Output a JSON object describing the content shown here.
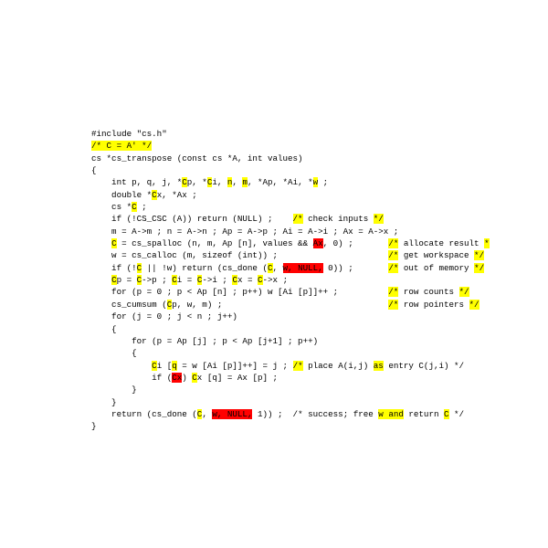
{
  "lines": [
    {
      "type": "plain",
      "text": "#include \"cs.h\""
    },
    {
      "type": "hl",
      "parts": [
        {
          "c": "hy",
          "t": "/* C = A' */"
        }
      ]
    },
    {
      "type": "plain",
      "text": "cs *cs_transpose (const cs *A, int values)"
    },
    {
      "type": "plain",
      "text": "{"
    },
    {
      "type": "hl",
      "parts": [
        {
          "c": "",
          "t": "    int p, q, j, *"
        },
        {
          "c": "hy",
          "t": "C"
        },
        {
          "c": "",
          "t": "p, *"
        },
        {
          "c": "hy",
          "t": "C"
        },
        {
          "c": "",
          "t": "i, "
        },
        {
          "c": "hy",
          "t": "n"
        },
        {
          "c": "",
          "t": ", "
        },
        {
          "c": "hy",
          "t": "m"
        },
        {
          "c": "",
          "t": ", *Ap, *Ai, *"
        },
        {
          "c": "hy",
          "t": "w"
        },
        {
          "c": "",
          "t": " ;"
        }
      ]
    },
    {
      "type": "hl",
      "parts": [
        {
          "c": "",
          "t": "    double *"
        },
        {
          "c": "hy",
          "t": "C"
        },
        {
          "c": "",
          "t": "x, *Ax ;"
        }
      ]
    },
    {
      "type": "hl",
      "parts": [
        {
          "c": "",
          "t": "    cs *"
        },
        {
          "c": "hy",
          "t": "C"
        },
        {
          "c": "",
          "t": " ;"
        }
      ]
    },
    {
      "type": "hl",
      "parts": [
        {
          "c": "",
          "t": "    if (!CS_CSC (A)) return (NULL) ;    "
        },
        {
          "c": "hy",
          "t": "/*"
        },
        {
          "c": "",
          "t": " check inputs "
        },
        {
          "c": "hy",
          "t": "*/"
        }
      ]
    },
    {
      "type": "plain",
      "text": "    m = A->m ; n = A->n ; Ap = A->p ; Ai = A->i ; Ax = A->x ;"
    },
    {
      "type": "hl",
      "parts": [
        {
          "c": "",
          "t": "    "
        },
        {
          "c": "hy",
          "t": "C"
        },
        {
          "c": "",
          "t": " = cs_spalloc (n, m, Ap [n], values && "
        },
        {
          "c": "hr",
          "t": "Ax"
        },
        {
          "c": "",
          "t": ", 0) ;       "
        },
        {
          "c": "hy",
          "t": "/*"
        },
        {
          "c": "",
          "t": " allocate result "
        },
        {
          "c": "hy",
          "t": "*"
        }
      ]
    },
    {
      "type": "hl",
      "parts": [
        {
          "c": "",
          "t": "    w = cs_calloc (m, sizeof (int)) ;                      "
        },
        {
          "c": "hy",
          "t": "/*"
        },
        {
          "c": "",
          "t": " get workspace "
        },
        {
          "c": "hy",
          "t": "*/"
        }
      ]
    },
    {
      "type": "hl",
      "parts": [
        {
          "c": "",
          "t": "    if (!"
        },
        {
          "c": "hy",
          "t": "C"
        },
        {
          "c": "",
          "t": " || !w) return (cs_done ("
        },
        {
          "c": "hy",
          "t": "C"
        },
        {
          "c": "",
          "t": ", "
        },
        {
          "c": "hr",
          "t": "w, NULL,"
        },
        {
          "c": "",
          "t": " 0)) ;       "
        },
        {
          "c": "hy",
          "t": "/*"
        },
        {
          "c": "",
          "t": " out of memory "
        },
        {
          "c": "hy",
          "t": "*/"
        }
      ]
    },
    {
      "type": "hl",
      "parts": [
        {
          "c": "",
          "t": "    "
        },
        {
          "c": "hy",
          "t": "C"
        },
        {
          "c": "",
          "t": "p = "
        },
        {
          "c": "hy",
          "t": "C"
        },
        {
          "c": "",
          "t": "->p ; "
        },
        {
          "c": "hy",
          "t": "C"
        },
        {
          "c": "",
          "t": "i = "
        },
        {
          "c": "hy",
          "t": "C"
        },
        {
          "c": "",
          "t": "->i ; "
        },
        {
          "c": "hy",
          "t": "C"
        },
        {
          "c": "",
          "t": "x = "
        },
        {
          "c": "hy",
          "t": "C"
        },
        {
          "c": "",
          "t": "->x ;"
        }
      ]
    },
    {
      "type": "hl",
      "parts": [
        {
          "c": "",
          "t": "    for (p = 0 ; p < Ap [n] ; p++) w [Ai [p]]++ ;          "
        },
        {
          "c": "hy",
          "t": "/*"
        },
        {
          "c": "",
          "t": " row counts "
        },
        {
          "c": "hy",
          "t": "*/"
        }
      ]
    },
    {
      "type": "hl",
      "parts": [
        {
          "c": "",
          "t": "    cs_cumsum ("
        },
        {
          "c": "hy",
          "t": "C"
        },
        {
          "c": "",
          "t": "p, w, m) ;                                 "
        },
        {
          "c": "hy",
          "t": "/*"
        },
        {
          "c": "",
          "t": " row pointers "
        },
        {
          "c": "hy",
          "t": "*/"
        }
      ]
    },
    {
      "type": "plain",
      "text": "    for (j = 0 ; j < n ; j++)"
    },
    {
      "type": "plain",
      "text": "    {"
    },
    {
      "type": "plain",
      "text": "        for (p = Ap [j] ; p < Ap [j+1] ; p++)"
    },
    {
      "type": "plain",
      "text": "        {"
    },
    {
      "type": "hl",
      "parts": [
        {
          "c": "",
          "t": "            "
        },
        {
          "c": "hy",
          "t": "C"
        },
        {
          "c": "",
          "t": "i ["
        },
        {
          "c": "hy",
          "t": "q"
        },
        {
          "c": "",
          "t": " = w [Ai [p]]++] = j ; "
        },
        {
          "c": "hy",
          "t": "/*"
        },
        {
          "c": "",
          "t": " place A(i,j) "
        },
        {
          "c": "hy",
          "t": "as"
        },
        {
          "c": "",
          "t": " entry C(j,i) */"
        }
      ]
    },
    {
      "type": "hl",
      "parts": [
        {
          "c": "",
          "t": "            if ("
        },
        {
          "c": "hr",
          "t": "Cx"
        },
        {
          "c": "",
          "t": ") "
        },
        {
          "c": "hy",
          "t": "C"
        },
        {
          "c": "",
          "t": "x [q] = Ax [p] ;"
        }
      ]
    },
    {
      "type": "plain",
      "text": "        }"
    },
    {
      "type": "plain",
      "text": "    }"
    },
    {
      "type": "hl",
      "parts": [
        {
          "c": "",
          "t": "    return (cs_done ("
        },
        {
          "c": "hy",
          "t": "C"
        },
        {
          "c": "",
          "t": ", "
        },
        {
          "c": "hr",
          "t": "w, NULL,"
        },
        {
          "c": "",
          "t": " 1)) ;  /* success; free "
        },
        {
          "c": "hy",
          "t": "w and"
        },
        {
          "c": "",
          "t": " return "
        },
        {
          "c": "hy",
          "t": "C"
        },
        {
          "c": "",
          "t": " */"
        }
      ]
    },
    {
      "type": "plain",
      "text": "}"
    }
  ]
}
